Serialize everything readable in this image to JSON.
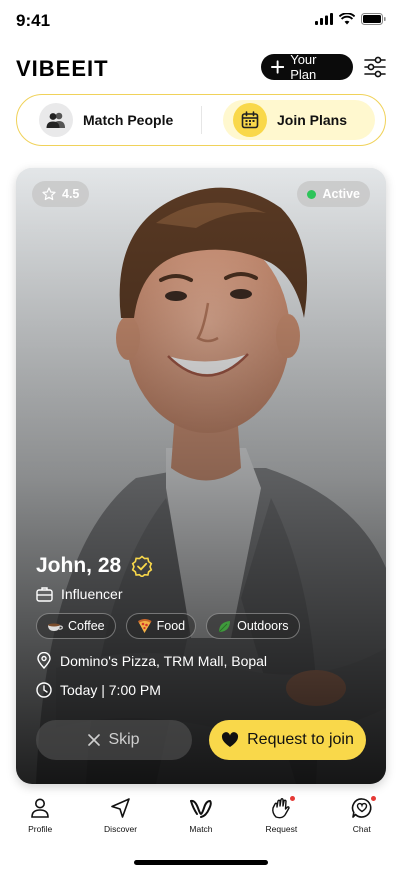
{
  "status": {
    "time": "9:41"
  },
  "header": {
    "logo": "VIBEEIT",
    "plan_button": "Your Plan"
  },
  "toggle": {
    "left_label": "Match People",
    "right_label": "Join Plans",
    "active": "Join Plans"
  },
  "card": {
    "rating": "4.5",
    "status": "Active",
    "name": "John, 28",
    "role": "Influencer",
    "tags": [
      {
        "label": "Coffee",
        "icon": "coffee-icon"
      },
      {
        "label": "Food",
        "icon": "pizza-icon"
      },
      {
        "label": "Outdoors",
        "icon": "leaf-icon"
      }
    ],
    "location": "Domino's Pizza, TRM Mall, Bopal",
    "time": "Today | 7:00 PM",
    "skip_label": "Skip",
    "join_label": "Request to join"
  },
  "nav": {
    "items": [
      {
        "label": "Profile",
        "icon": "person-icon"
      },
      {
        "label": "Discover",
        "icon": "navigation-arrow-icon"
      },
      {
        "label": "Match",
        "icon": "vibe-logo-icon"
      },
      {
        "label": "Request",
        "icon": "waving-hand-icon"
      },
      {
        "label": "Chat",
        "icon": "chat-heart-icon"
      }
    ]
  },
  "colors": {
    "accent": "#f9d84a",
    "active_dot": "#2ec45a",
    "notification": "#e53935"
  }
}
